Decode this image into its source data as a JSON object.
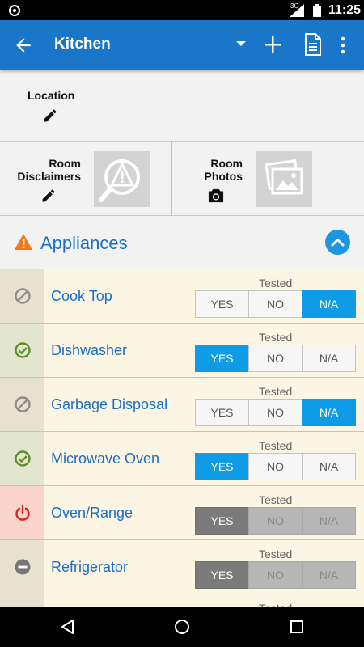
{
  "status_bar": {
    "time": "11:25",
    "network": "3G",
    "icons": [
      "notification-icon",
      "signal-icon",
      "battery-icon"
    ]
  },
  "app_bar": {
    "title": "Kitchen",
    "icons": [
      "back-arrow-icon",
      "dropdown-icon",
      "add-icon",
      "document-icon",
      "more-vert-icon"
    ]
  },
  "location": {
    "label": "Location"
  },
  "room": {
    "disclaimers_label": "Room\nDisclaimers",
    "photos_label": "Room\nPhotos"
  },
  "appliances": {
    "title": "Appliances",
    "items": [
      {
        "name": "Cook Top",
        "tested_label": "Tested",
        "status": "na-icon",
        "selected": "N/A",
        "disabled": false,
        "options": [
          "YES",
          "NO",
          "N/A"
        ]
      },
      {
        "name": "Dishwasher",
        "tested_label": "Tested",
        "status": "check-icon",
        "selected": "YES",
        "disabled": false,
        "options": [
          "YES",
          "NO",
          "N/A"
        ]
      },
      {
        "name": "Garbage Disposal",
        "tested_label": "Tested",
        "status": "na-icon",
        "selected": "N/A",
        "disabled": false,
        "options": [
          "YES",
          "NO",
          "N/A"
        ]
      },
      {
        "name": "Microwave Oven",
        "tested_label": "Tested",
        "status": "check-icon",
        "selected": "YES",
        "disabled": false,
        "options": [
          "YES",
          "NO",
          "N/A"
        ]
      },
      {
        "name": "Oven/Range",
        "tested_label": "Tested",
        "status": "power-icon",
        "selected": "YES",
        "disabled": true,
        "options": [
          "YES",
          "NO",
          "N/A"
        ]
      },
      {
        "name": "Refrigerator",
        "tested_label": "Tested",
        "status": "minus-icon",
        "selected": "YES",
        "disabled": true,
        "options": [
          "YES",
          "NO",
          "N/A"
        ]
      },
      {
        "name": "",
        "tested_label": "Tested",
        "status": "",
        "selected": "",
        "disabled": false,
        "options": []
      }
    ]
  },
  "colors": {
    "app_bar": "#1976c9",
    "accent_blue": "#0f9ce6",
    "link_blue": "#1a6fc2",
    "row_bg": "#fdf5e3",
    "warning": "#f07a1a",
    "check_green": "#5f8f2a",
    "power_red": "#e02020"
  }
}
